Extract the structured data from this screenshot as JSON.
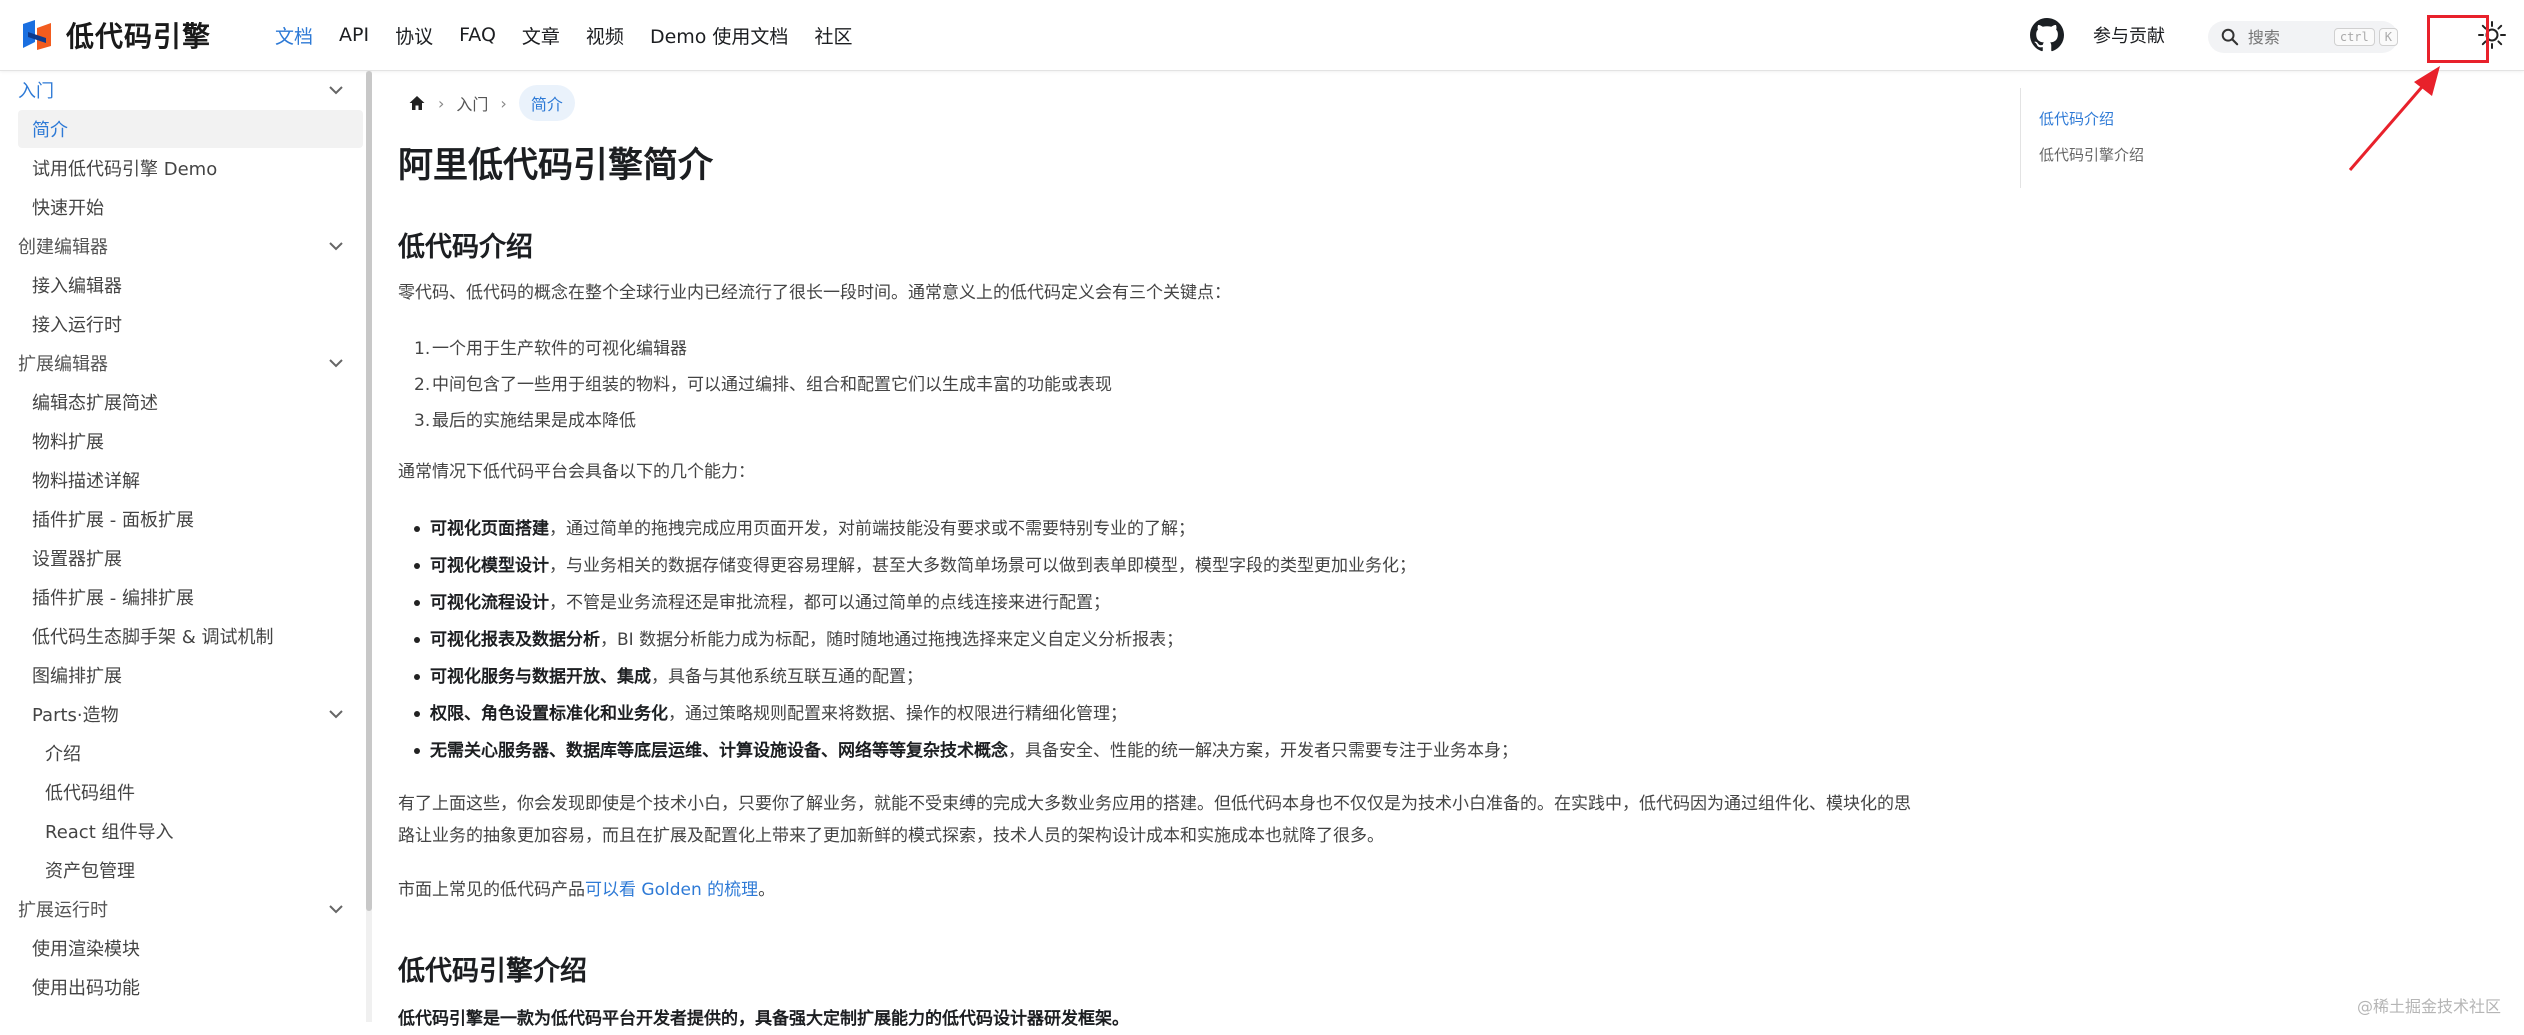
{
  "navbar": {
    "brand_name": "低代码引擎",
    "links": [
      "文档",
      "API",
      "协议",
      "FAQ",
      "文章",
      "视频",
      "Demo 使用文档",
      "社区"
    ],
    "active_link": "文档",
    "contribute_label": "参与贡献",
    "search_placeholder": "搜索",
    "search_kbd_ctrl": "ctrl",
    "search_kbd_k": "K",
    "icons": [
      "logo-icon",
      "github-icon",
      "search-icon",
      "sun-icon"
    ]
  },
  "sidebar": {
    "items": [
      {
        "label": "入门",
        "type": "category",
        "open": true
      },
      {
        "label": "简介",
        "type": "link",
        "active": true
      },
      {
        "label": "试用低代码引擎 Demo",
        "type": "link"
      },
      {
        "label": "快速开始",
        "type": "link"
      },
      {
        "label": "创建编辑器",
        "type": "category"
      },
      {
        "label": "接入编辑器",
        "type": "link"
      },
      {
        "label": "接入运行时",
        "type": "link"
      },
      {
        "label": "扩展编辑器",
        "type": "category"
      },
      {
        "label": "编辑态扩展简述",
        "type": "link"
      },
      {
        "label": "物料扩展",
        "type": "link"
      },
      {
        "label": "物料描述详解",
        "type": "link"
      },
      {
        "label": "插件扩展 - 面板扩展",
        "type": "link"
      },
      {
        "label": "设置器扩展",
        "type": "link"
      },
      {
        "label": "插件扩展 - 编排扩展",
        "type": "link"
      },
      {
        "label": "低代码生态脚手架 & 调试机制",
        "type": "link"
      },
      {
        "label": "图编排扩展",
        "type": "link"
      },
      {
        "label": "Parts·造物",
        "type": "subcategory"
      },
      {
        "label": "介绍",
        "type": "sublink"
      },
      {
        "label": "低代码组件",
        "type": "sublink"
      },
      {
        "label": "React 组件导入",
        "type": "sublink"
      },
      {
        "label": "资产包管理",
        "type": "sublink"
      },
      {
        "label": "扩展运行时",
        "type": "category"
      },
      {
        "label": "使用渲染模块",
        "type": "link"
      },
      {
        "label": "使用出码功能",
        "type": "link"
      }
    ]
  },
  "breadcrumb": {
    "items": [
      "入门",
      "简介"
    ]
  },
  "content": {
    "title": "阿里低代码引擎简介",
    "h2_1": "低代码介绍",
    "p1": "零代码、低代码的概念在整个全球行业内已经流行了很长一段时间。通常意义上的低代码定义会有三个关键点：",
    "ol": [
      {
        "num": "1.",
        "text": "一个用于生产软件的可视化编辑器"
      },
      {
        "num": "2.",
        "text": "中间包含了一些用于组装的物料，可以通过编排、组合和配置它们以生成丰富的功能或表现"
      },
      {
        "num": "3.",
        "text": "最后的实施结果是成本降低"
      }
    ],
    "p2": "通常情况下低代码平台会具备以下的几个能力：",
    "ul": [
      {
        "bold": "可视化页面搭建",
        "text": "，通过简单的拖拽完成应用页面开发，对前端技能没有要求或不需要特别专业的了解；"
      },
      {
        "bold": "可视化模型设计",
        "text": "，与业务相关的数据存储变得更容易理解，甚至大多数简单场景可以做到表单即模型，模型字段的类型更加业务化；"
      },
      {
        "bold": "可视化流程设计",
        "text": "，不管是业务流程还是审批流程，都可以通过简单的点线连接来进行配置；"
      },
      {
        "bold": "可视化报表及数据分析",
        "text": "，BI 数据分析能力成为标配，随时随地通过拖拽选择来定义自定义分析报表；"
      },
      {
        "bold": "可视化服务与数据开放、集成",
        "text": "，具备与其他系统互联互通的配置；"
      },
      {
        "bold": "权限、角色设置标准化和业务化",
        "text": "，通过策略规则配置来将数据、操作的权限进行精细化管理；"
      },
      {
        "bold": "无需关心服务器、数据库等底层运维、计算设施设备、网络等等复杂技术概念",
        "text": "，具备安全、性能的统一解决方案，开发者只需要专注于业务本身；"
      }
    ],
    "p3_line1": "有了上面这些，你会发现即使是个技术小白，只要你了解业务，就能不受束缚的完成大多数业务应用的搭建。但低代码本身也不仅仅是为技术小白准备的。在实践中，低代码因为通过组件化、模块化的思",
    "p3_line2": "路让业务的抽象更加容易，而且在扩展及配置化上带来了更加新鲜的模式探索，技术人员的架构设计成本和实施成本也就降了很多。",
    "p4_prefix": "市面上常见的低代码产品",
    "p4_link": "可以看 Golden 的梳理",
    "p4_suffix": "。",
    "h2_2": "低代码引擎介绍",
    "p5_partial": "低代码引擎是一款为低代码平台开发者提供的，具备强大定制扩展能力的低代码设计器研发框架。"
  },
  "toc": {
    "items": [
      "低代码介绍",
      "低代码引擎介绍"
    ],
    "active": "低代码介绍"
  },
  "watermark": "@稀土掘金技术社区",
  "colors": {
    "accent": "#2e7ad6",
    "annotation_red": "#e8212b",
    "text": "#1c1e21"
  }
}
